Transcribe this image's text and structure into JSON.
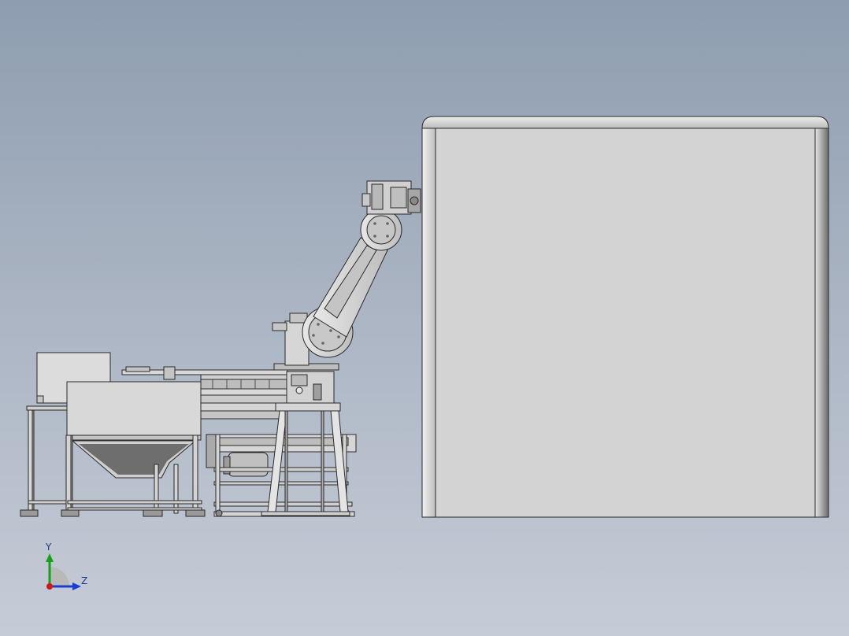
{
  "viewport": {
    "background_top": "#8e9db0",
    "background_bottom": "#c6ccd7",
    "model_line_color": "#2a2a2a",
    "model_fill_color": "#d4d4d4"
  },
  "model": {
    "components": [
      "enclosure",
      "robot-arm",
      "conveyor-table",
      "hopper-station",
      "control-cabinet"
    ]
  },
  "triad": {
    "y_label": "Y",
    "z_label": "Z",
    "y_axis_color": "#18a018",
    "z_axis_color": "#1a3fd0",
    "x_axis_color": "#d01818"
  }
}
